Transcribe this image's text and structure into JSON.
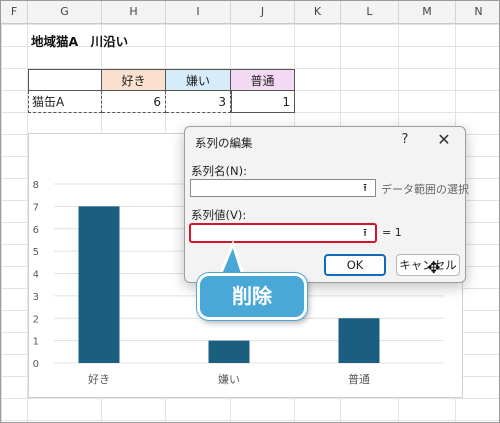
{
  "columns": [
    "F",
    "G",
    "H",
    "I",
    "J",
    "K",
    "L",
    "M",
    "N"
  ],
  "sheet_title": "地域猫A　川沿い",
  "table": {
    "headers": [
      "好き",
      "嫌い",
      "普通"
    ],
    "row_label": "猫缶A",
    "values": [
      "6",
      "3",
      "1"
    ]
  },
  "chart_data": {
    "type": "bar",
    "categories": [
      "好き",
      "嫌い",
      "普通"
    ],
    "values": [
      7,
      1,
      2
    ],
    "y_ticks": [
      "0",
      "1",
      "2",
      "3",
      "4",
      "5",
      "6",
      "7",
      "8"
    ],
    "ylim": [
      0,
      8
    ],
    "bar_color": "#1b5e80"
  },
  "dialog": {
    "title": "系列の編集",
    "help": "?",
    "close": "✕",
    "series_name_label": "系列名(N):",
    "series_name_value": "",
    "series_name_hint": "データ範囲の選択",
    "series_values_label": "系列値(V):",
    "series_values_value": "",
    "series_values_result": "= 1",
    "range_icon": "⭱",
    "ok": "OK",
    "cancel": "キャンセル"
  },
  "callout": {
    "text": "削除",
    "color": "#4aa8d8"
  },
  "colors": {
    "highlight_red": "#d7152a",
    "accent_blue": "#0f6cbd"
  }
}
